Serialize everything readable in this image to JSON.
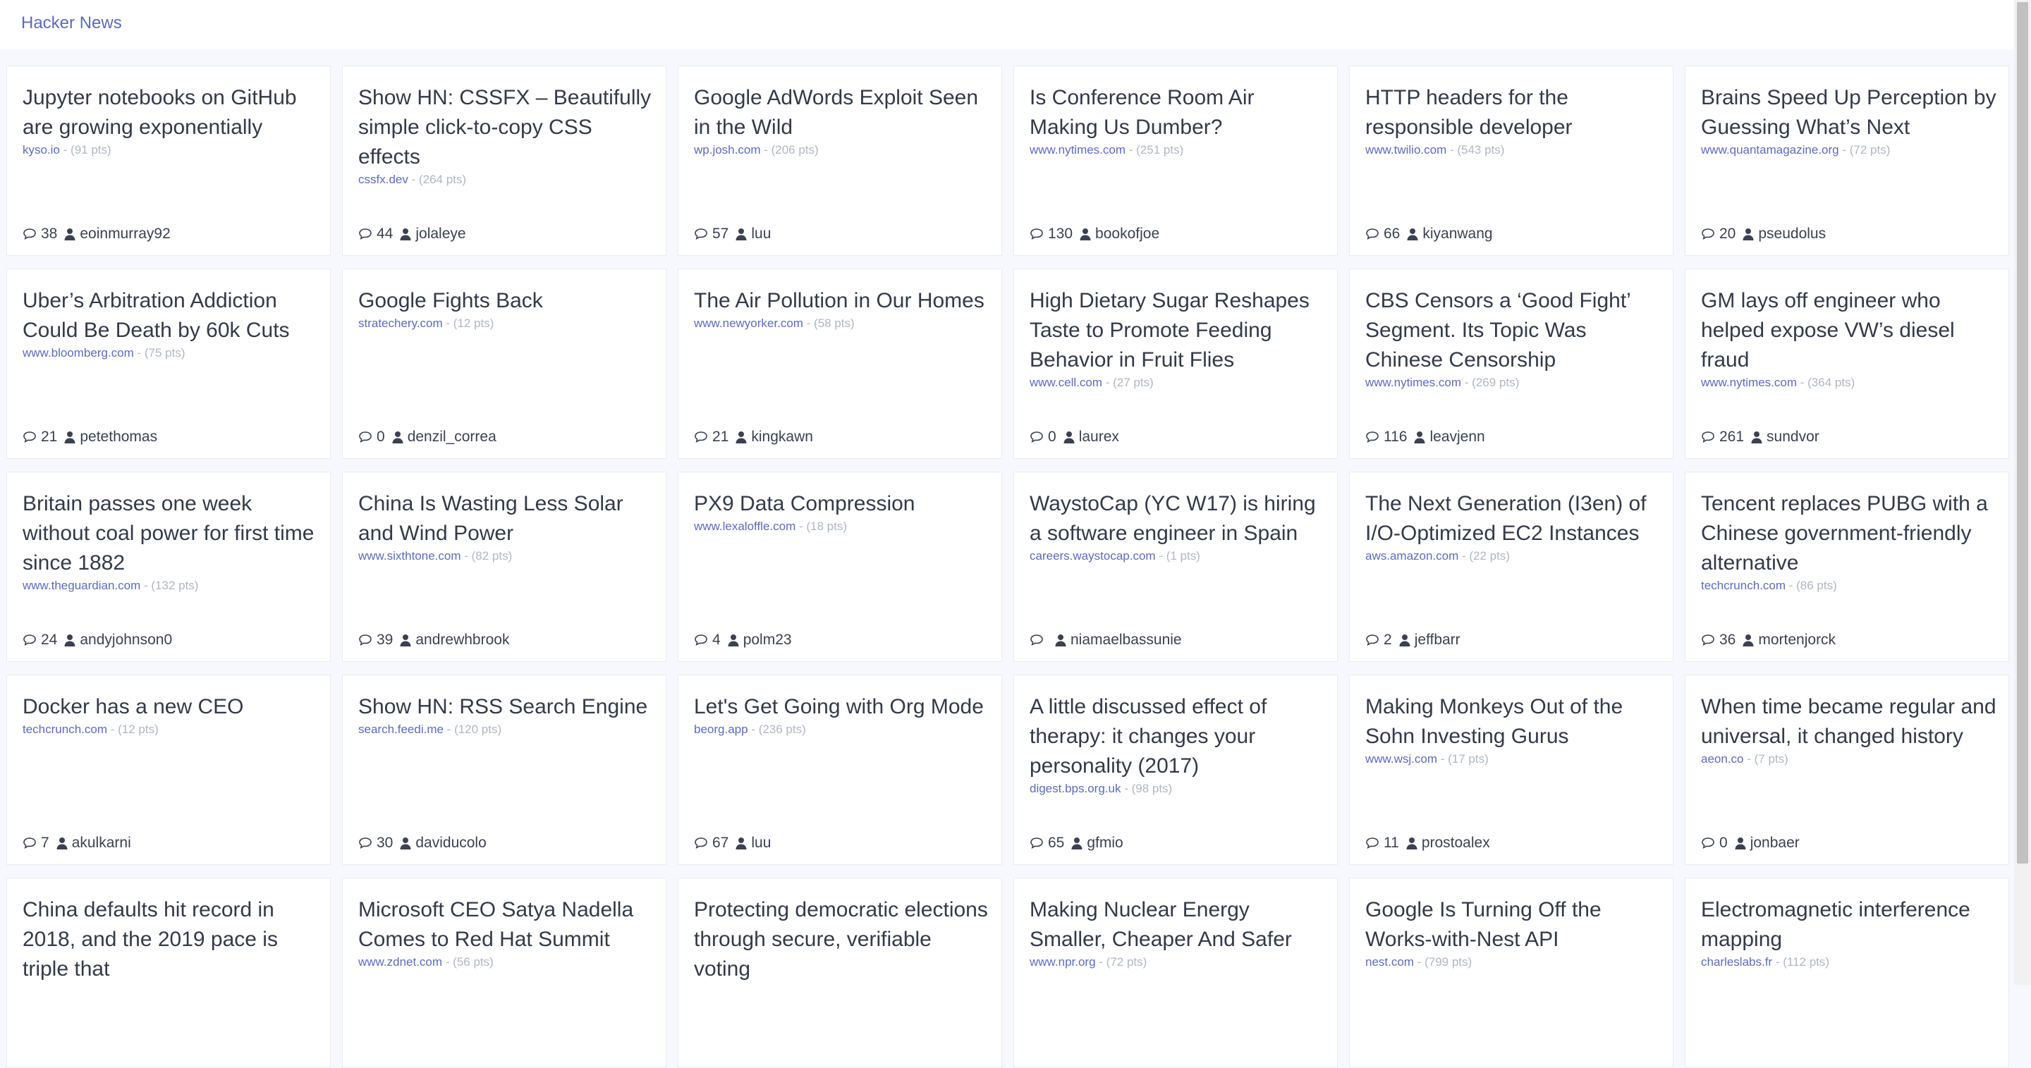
{
  "app": {
    "brand": "Hacker News"
  },
  "stories": [
    {
      "title": "Jupyter notebooks on GitHub are growing exponentially",
      "domain": "kyso.io",
      "points": "(91 pts)",
      "comments": "38",
      "user": "eoinmurray92"
    },
    {
      "title": "Show HN: CSSFX – Beautifully simple click-to-copy CSS effects",
      "domain": "cssfx.dev",
      "points": "(264 pts)",
      "comments": "44",
      "user": "jolaleye"
    },
    {
      "title": "Google AdWords Exploit Seen in the Wild",
      "domain": "wp.josh.com",
      "points": "(206 pts)",
      "comments": "57",
      "user": "luu"
    },
    {
      "title": "Is Conference Room Air Making Us Dumber?",
      "domain": "www.nytimes.com",
      "points": "(251 pts)",
      "comments": "130",
      "user": "bookofjoe"
    },
    {
      "title": "HTTP headers for the responsible developer",
      "domain": "www.twilio.com",
      "points": "(543 pts)",
      "comments": "66",
      "user": "kiyanwang"
    },
    {
      "title": "Brains Speed Up Perception by Guessing What’s Next",
      "domain": "www.quantamagazine.org",
      "points": "(72 pts)",
      "comments": "20",
      "user": "pseudolus"
    },
    {
      "title": "Uber’s Arbitration Addiction Could Be Death by 60k Cuts",
      "domain": "www.bloomberg.com",
      "points": "(75 pts)",
      "comments": "21",
      "user": "petethomas"
    },
    {
      "title": "Google Fights Back",
      "domain": "stratechery.com",
      "points": "(12 pts)",
      "comments": "0",
      "user": "denzil_correa"
    },
    {
      "title": "The Air Pollution in Our Homes",
      "domain": "www.newyorker.com",
      "points": "(58 pts)",
      "comments": "21",
      "user": "kingkawn"
    },
    {
      "title": "High Dietary Sugar Reshapes Taste to Promote Feeding Behavior in Fruit Flies",
      "domain": "www.cell.com",
      "points": "(27 pts)",
      "comments": "0",
      "user": "laurex"
    },
    {
      "title": "CBS Censors a ‘Good Fight’ Segment. Its Topic Was Chinese Censorship",
      "domain": "www.nytimes.com",
      "points": "(269 pts)",
      "comments": "116",
      "user": "leavjenn"
    },
    {
      "title": "GM lays off engineer who helped expose VW’s diesel fraud",
      "domain": "www.nytimes.com",
      "points": "(364 pts)",
      "comments": "261",
      "user": "sundvor"
    },
    {
      "title": "Britain passes one week without coal power for first time since 1882",
      "domain": "www.theguardian.com",
      "points": "(132 pts)",
      "comments": "24",
      "user": "andyjohnson0"
    },
    {
      "title": "China Is Wasting Less Solar and Wind Power",
      "domain": "www.sixthtone.com",
      "points": "(82 pts)",
      "comments": "39",
      "user": "andrewhbrook"
    },
    {
      "title": "PX9 Data Compression",
      "domain": "www.lexaloffle.com",
      "points": "(18 pts)",
      "comments": "4",
      "user": "polm23"
    },
    {
      "title": "WaystoCap (YC W17) is hiring a software engineer in Spain",
      "domain": "careers.waystocap.com",
      "points": "(1 pts)",
      "comments": "",
      "user": "niamaelbassunie"
    },
    {
      "title": "The Next Generation (I3en) of I/O-Optimized EC2 Instances",
      "domain": "aws.amazon.com",
      "points": "(22 pts)",
      "comments": "2",
      "user": "jeffbarr"
    },
    {
      "title": "Tencent replaces PUBG with a Chinese government-friendly alternative",
      "domain": "techcrunch.com",
      "points": "(86 pts)",
      "comments": "36",
      "user": "mortenjorck"
    },
    {
      "title": "Docker has a new CEO",
      "domain": "techcrunch.com",
      "points": "(12 pts)",
      "comments": "7",
      "user": "akulkarni"
    },
    {
      "title": "Show HN: RSS Search Engine",
      "domain": "search.feedi.me",
      "points": "(120 pts)",
      "comments": "30",
      "user": "daviducolo"
    },
    {
      "title": "Let's Get Going with Org Mode",
      "domain": "beorg.app",
      "points": "(236 pts)",
      "comments": "67",
      "user": "luu"
    },
    {
      "title": "A little discussed effect of therapy: it changes your personality (2017)",
      "domain": "digest.bps.org.uk",
      "points": "(98 pts)",
      "comments": "65",
      "user": "gfmio"
    },
    {
      "title": "Making Monkeys Out of the Sohn Investing Gurus",
      "domain": "www.wsj.com",
      "points": "(17 pts)",
      "comments": "11",
      "user": "prostoalex"
    },
    {
      "title": "When time became regular and universal, it changed history",
      "domain": "aeon.co",
      "points": "(7 pts)",
      "comments": "0",
      "user": "jonbaer"
    },
    {
      "title": "China defaults hit record in 2018, and the 2019 pace is triple that",
      "domain": "",
      "points": "",
      "comments": "",
      "user": ""
    },
    {
      "title": "Microsoft CEO Satya Nadella Comes to Red Hat Summit",
      "domain": "www.zdnet.com",
      "points": "(56 pts)",
      "comments": "",
      "user": ""
    },
    {
      "title": "Protecting democratic elections through secure, verifiable voting",
      "domain": "",
      "points": "",
      "comments": "",
      "user": ""
    },
    {
      "title": "Making Nuclear Energy Smaller, Cheaper And Safer",
      "domain": "www.npr.org",
      "points": "(72 pts)",
      "comments": "",
      "user": ""
    },
    {
      "title": "Google Is Turning Off the Works-with-Nest API",
      "domain": "nest.com",
      "points": "(799 pts)",
      "comments": "",
      "user": ""
    },
    {
      "title": "Electromagnetic interference mapping",
      "domain": "charleslabs.fr",
      "points": "(112 pts)",
      "comments": "",
      "user": ""
    }
  ],
  "meta": {
    "separator": " - "
  },
  "icons": {
    "comment": "comment-icon",
    "user": "user-icon"
  },
  "colors": {
    "brand": "#5c6bc0",
    "title": "#333a48",
    "muted": "#b0b6c3",
    "background": "#f7f8fd"
  }
}
